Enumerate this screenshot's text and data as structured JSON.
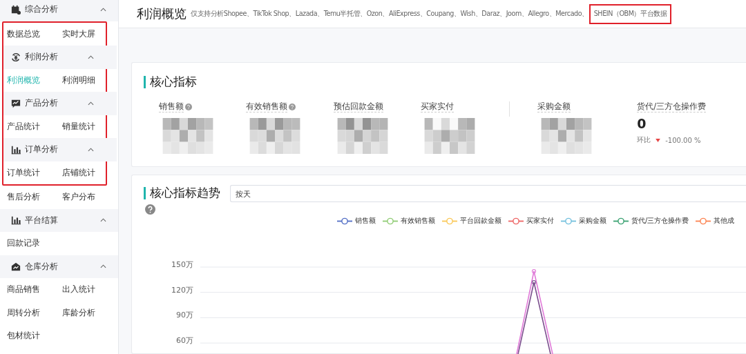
{
  "sidebar": {
    "groups": [
      {
        "title": "综合分析",
        "expanded": true,
        "items": [
          {
            "label": "数据总览",
            "selected": false
          },
          {
            "label": "实时大屏",
            "selected": false
          }
        ]
      },
      {
        "title": "利润分析",
        "expanded": true,
        "items": [
          {
            "label": "利润概览",
            "selected": true
          },
          {
            "label": "利润明细",
            "selected": false
          }
        ]
      },
      {
        "title": "产品分析",
        "expanded": true,
        "items": [
          {
            "label": "产品统计",
            "selected": false
          },
          {
            "label": "销量统计",
            "selected": false
          }
        ]
      },
      {
        "title": "订单分析",
        "expanded": true,
        "items": [
          {
            "label": "订单统计",
            "selected": false
          },
          {
            "label": "店铺统计",
            "selected": false
          },
          {
            "label": "售后分析",
            "selected": false
          },
          {
            "label": "客户分布",
            "selected": false
          }
        ]
      },
      {
        "title": "平台结算",
        "expanded": true,
        "items": [
          {
            "label": "回款记录",
            "selected": false
          }
        ]
      },
      {
        "title": "仓库分析",
        "expanded": true,
        "items": [
          {
            "label": "商品销售",
            "selected": false
          },
          {
            "label": "出入统计",
            "selected": false
          },
          {
            "label": "周转分析",
            "selected": false
          },
          {
            "label": "库龄分析",
            "selected": false
          },
          {
            "label": "包材统计",
            "selected": false
          }
        ]
      }
    ]
  },
  "header": {
    "title": "利润概览",
    "note": "仅支持分析Shopee、TikTok Shop、Lazada、Temu半托管、Ozon、AliExpress、Coupang、Wish、Daraz、Joom、Allegro、Mercado、",
    "note_highlighted": "SHEIN（OBM）平台数据"
  },
  "core_metrics": {
    "title": "核心指标",
    "groups": [
      [
        {
          "label": "销售额",
          "help": true,
          "kind": "masked"
        },
        {
          "label": "有效销售额",
          "help": true,
          "kind": "masked"
        },
        {
          "label": "预估回款金额",
          "help": false,
          "kind": "masked"
        },
        {
          "label": "买家实付",
          "help": false,
          "kind": "masked"
        }
      ],
      [
        {
          "label": "采购金额",
          "help": false,
          "kind": "masked"
        },
        {
          "label": "货代/三方仓操作费",
          "help": false,
          "kind": "value",
          "value": "0",
          "change": {
            "label": "环比",
            "decrease": true,
            "text": "-100.00 %"
          }
        }
      ]
    ]
  },
  "trend": {
    "title": "核心指标趋势",
    "help": true,
    "period": {
      "value": "按天"
    },
    "legend": [
      {
        "name": "销售额",
        "color": "#5470c6"
      },
      {
        "name": "有效销售额",
        "color": "#91cc75"
      },
      {
        "name": "平台回款金额",
        "color": "#fac858"
      },
      {
        "name": "买家实付",
        "color": "#ee6666"
      },
      {
        "name": "采购金额",
        "color": "#73c0de"
      },
      {
        "name": "货代/三方仓操作费",
        "color": "#3ba272"
      },
      {
        "name": "其他成",
        "color": "#fc8452"
      }
    ],
    "y_axis_labels": [
      "150万",
      "120万",
      "90万",
      "60万"
    ]
  }
}
